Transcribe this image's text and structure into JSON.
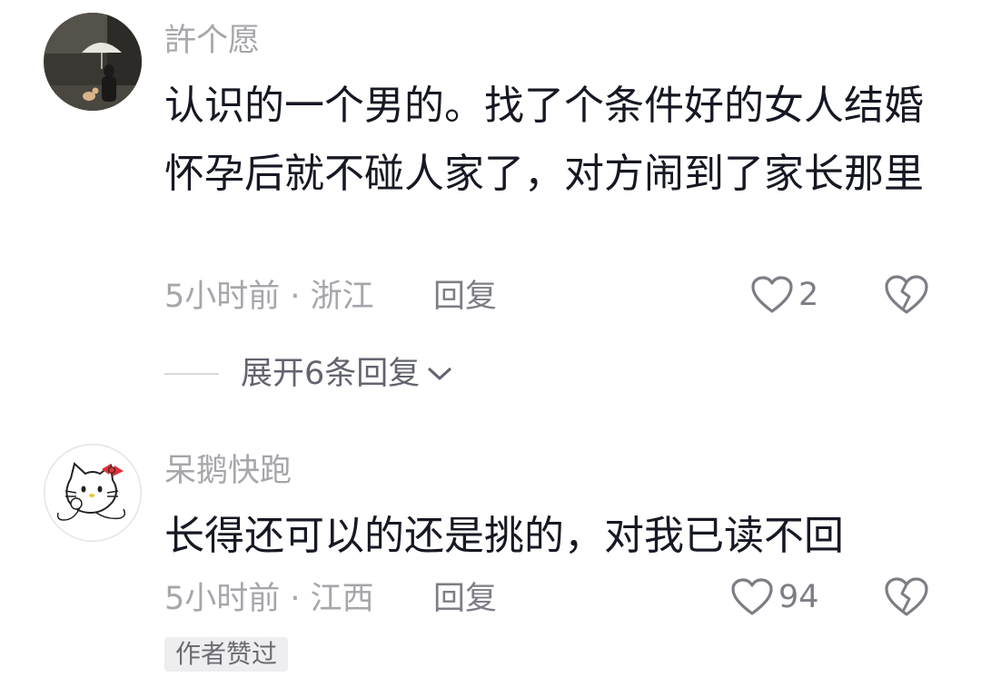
{
  "comments": [
    {
      "username": "許个愿",
      "content": "认识的一个男的。找了个条件好的女人结婚 怀孕后就不碰人家了，对方闹到了家长那里",
      "meta": "5小时前 · 浙江",
      "reply_label": "回复",
      "like_count": "2",
      "avatar_icon": "avatar-photo-umbrella-icon"
    },
    {
      "username": "呆鹅快跑",
      "content": "长得还可以的还是挑的，对我已读不回",
      "meta": "5小时前 · 江西",
      "reply_label": "回复",
      "like_count": "94",
      "avatar_icon": "avatar-cartoon-cat-icon",
      "badge": "作者赞过"
    }
  ],
  "expand_replies_label": "展开6条回复",
  "icons": {
    "like": "heart-outline-icon",
    "dislike": "broken-heart-icon",
    "expand": "chevron-down-icon"
  },
  "colors": {
    "text_primary": "#161823",
    "text_secondary": "#a6a6ab",
    "icon_gray": "#7d7e85"
  }
}
